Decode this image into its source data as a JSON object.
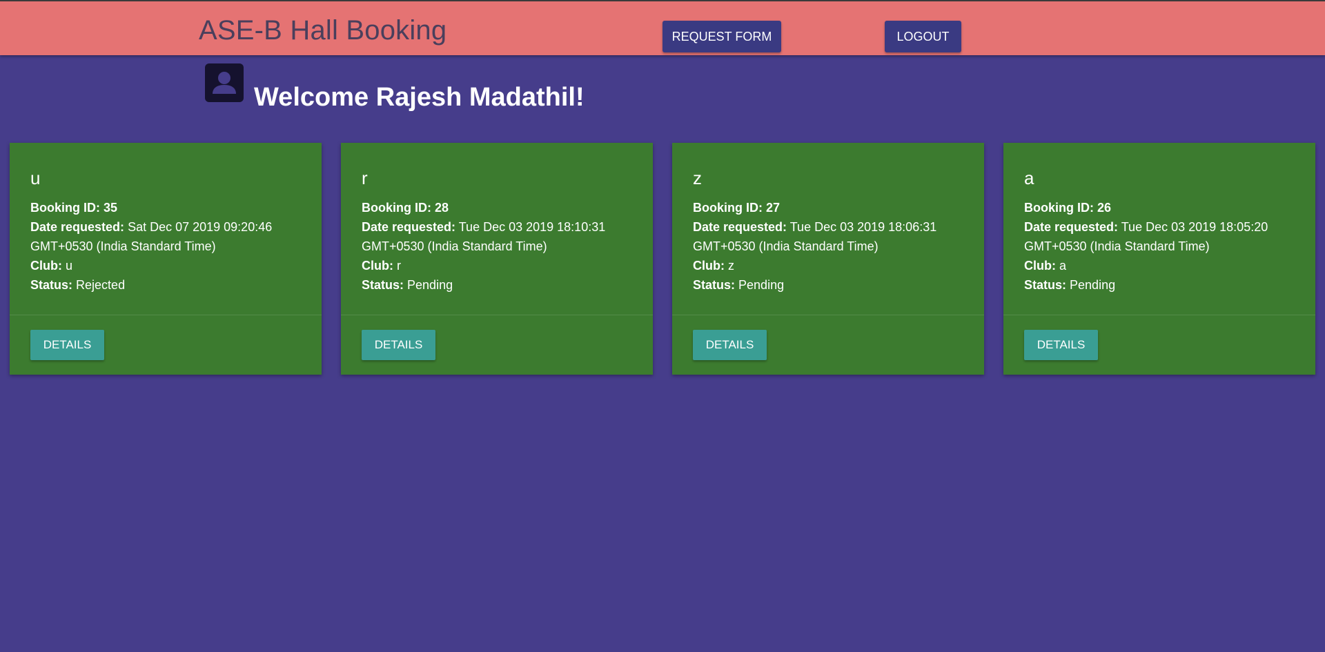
{
  "header": {
    "title": "ASE-B Hall Booking",
    "request_form_label": "REQUEST FORM",
    "logout_label": "LOGOUT",
    "bar_color": "#e57373",
    "button_color": "#3a3a82"
  },
  "welcome": {
    "avatar_icon": "account-box-icon",
    "text": "Welcome Rajesh Madathil!"
  },
  "labels": {
    "booking_id": "Booking ID:",
    "date_requested": "Date requested:",
    "club": "Club:",
    "status": "Status:"
  },
  "bookings": [
    {
      "title": "u",
      "booking_id": "35",
      "date_line1": "Sat Dec 07 2019 09:20:46",
      "date_line2": "GMT+0530 (India Standard Time)",
      "club": "u",
      "status": "Rejected",
      "details_label": "DETAILS"
    },
    {
      "title": "r",
      "booking_id": "28",
      "date_line1": "Tue Dec 03 2019 18:10:31",
      "date_line2": "GMT+0530 (India Standard Time)",
      "club": "r",
      "status": "Pending",
      "details_label": "DETAILS"
    },
    {
      "title": "z",
      "booking_id": "27",
      "date_line1": "Tue Dec 03 2019 18:06:31",
      "date_line2": "GMT+0530 (India Standard Time)",
      "club": "z",
      "status": "Pending",
      "details_label": "DETAILS"
    },
    {
      "title": "a",
      "booking_id": "26",
      "date_line1": "Tue Dec 03 2019 18:05:20",
      "date_line2": "GMT+0530 (India Standard Time)",
      "club": "a",
      "status": "Pending",
      "details_label": "DETAILS"
    }
  ],
  "colors": {
    "page_background": "#463d8b",
    "card_background": "#3c7b2f",
    "details_button": "#3a9e94"
  }
}
